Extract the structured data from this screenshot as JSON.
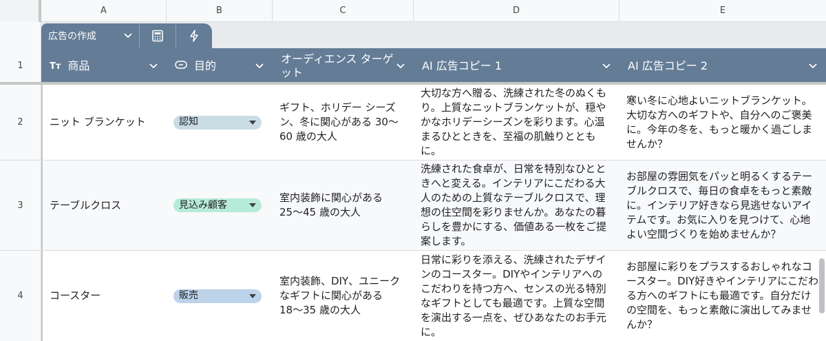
{
  "columns": [
    "A",
    "B",
    "C",
    "D",
    "E"
  ],
  "tabs": {
    "table_name": "広告の作成",
    "calc_icon": "calculator-icon",
    "bolt_icon": "lightning-icon"
  },
  "header": {
    "row_number": "1",
    "product": "商品",
    "product_icon_text": "Tт",
    "objective": "目的",
    "audience": "オーディエンス ターゲット",
    "copy1": "AI 広告コピー 1",
    "copy2": "AI 広告コピー 2"
  },
  "colors": {
    "header_bg": "#647c96",
    "chip_awareness": "#c9dce4",
    "chip_prospect": "#b7ebd9",
    "chip_sales": "#bcd3ea"
  },
  "rows": [
    {
      "num": "2",
      "product": "ニット ブランケット",
      "objective": "認知",
      "audience": "ギフト、ホリデー シーズン、冬に関心がある 30〜60 歳の大人",
      "copy1": "大切な方へ贈る、洗練された冬のぬくもり。上質なニットブランケットが、穏やかなホリデーシーズンを彩ります。心温まるひとときを、至福の肌触りとともに。",
      "copy2": "寒い冬に心地よいニットブランケット。大切な方へのギフトや、自分へのご褒美に。今年の冬を、もっと暖かく過ごしませんか？"
    },
    {
      "num": "3",
      "product": "テーブルクロス",
      "objective": "見込み顧客",
      "audience": "室内装飾に関心がある 25〜45 歳の大人",
      "copy1": "洗練された食卓が、日常を特別なひとときへと変える。インテリアにこだわる大人のための上質なテーブルクロスで、理想の住空間を彩りませんか。あなたの暮らしを豊かにする、価値ある一枚をご提案します。",
      "copy2": "お部屋の雰囲気をパッと明るくするテーブルクロスで、毎日の食卓をもっと素敵に。インテリア好きなら見逃せないアイテムです。お気に入りを見つけて、心地よい空間づくりを始めませんか？"
    },
    {
      "num": "4",
      "product": "コースター",
      "objective": "販売",
      "audience": "室内装飾、DIY、ユニークなギフトに関心がある 18〜35 歳の大人",
      "copy1": "日常に彩りを添える、洗練されたデザインのコースター。DIYやインテリアへのこだわりを持つ方へ、センスの光る特別なギフトとしても最適です。上質な空間を演出する一点を、ぜひあなたのお手元に。",
      "copy2": "お部屋に彩りをプラスするおしゃれなコースター。DIY好きやインテリアにこだわる方へのギフトにも最適です。自分だけの空間を、もっと素敵に演出してみませんか？"
    }
  ]
}
